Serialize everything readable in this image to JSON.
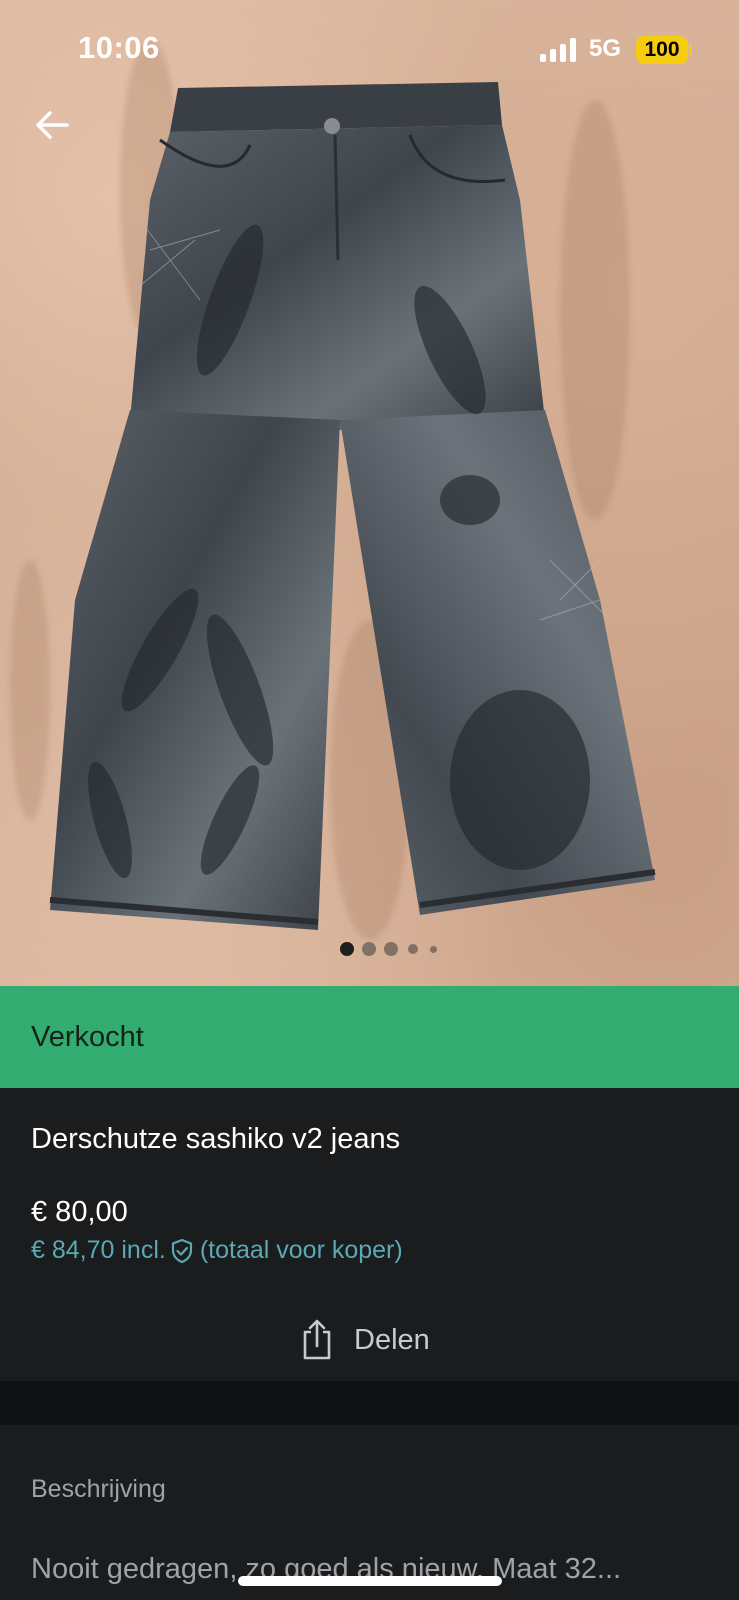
{
  "status_bar": {
    "time": "10:06",
    "network": "5G",
    "battery": "100"
  },
  "photo": {
    "subject": "jeans",
    "page_count": 5,
    "current_page": 1
  },
  "listing": {
    "status": "Verkocht",
    "title": "Derschutze sashiko v2 jeans",
    "price": "€ 80,00",
    "price_incl": "€ 84,70 incl.",
    "price_incl_note": "(totaal voor koper)",
    "share_label": "Delen"
  },
  "description": {
    "header": "Beschrijving",
    "text": "Nooit gedragen, zo goed als nieuw. Maat 32..."
  },
  "colors": {
    "sold_banner": "#33ac72",
    "background": "#1a1c1e",
    "accent_link": "#5aa9b3"
  },
  "icons": {
    "back": "arrow-left-icon",
    "share": "share-icon",
    "buyer_protection": "shield-check-icon"
  }
}
